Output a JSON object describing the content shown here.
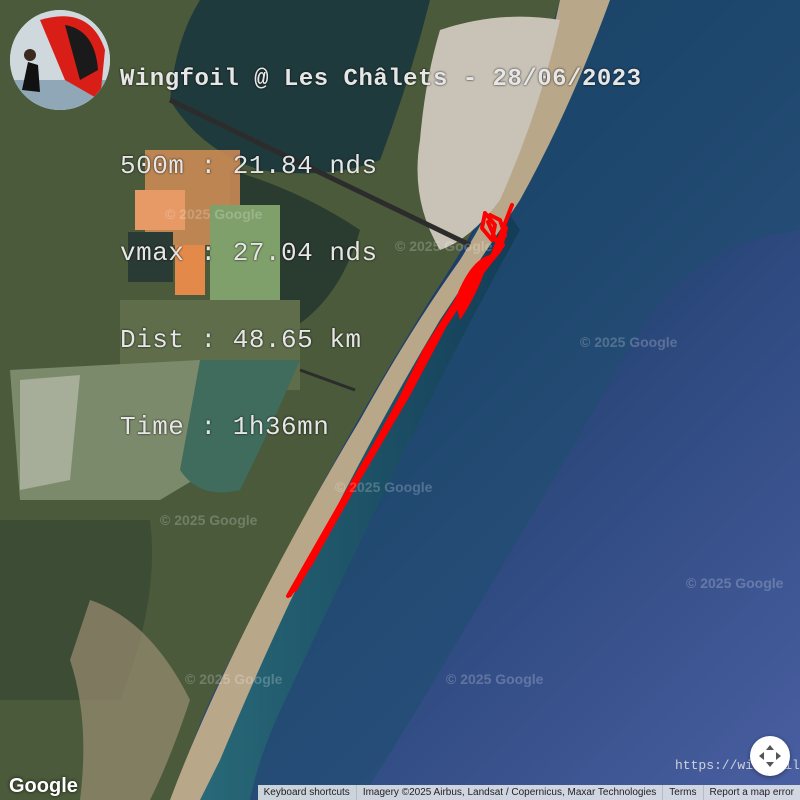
{
  "overlay": {
    "title": "Wingfoil @ Les Châlets - 28/06/2023",
    "stat_500m": "500m : 21.84 nds",
    "stat_vmax": "vmax : 27.04 nds",
    "stat_dist": "Dist : 48.65 km",
    "stat_time": "Time : 1h36mn"
  },
  "track": {
    "color": "#ff0000"
  },
  "watermarks": [
    "© 2025 Google",
    "© 2025 Google",
    "© 2025 Google",
    "© 2025 Google",
    "© 2025 Google",
    "© 2025 Google",
    "© 2025 Google",
    "© 2025 Google"
  ],
  "site_url": "https://windfoil.org",
  "google_logo": "Google",
  "attribution": {
    "shortcuts": "Keyboard shortcuts",
    "imagery": "Imagery ©2025 Airbus, Landsat / Copernicus, Maxar Technologies",
    "terms": "Terms",
    "report": "Report a map error"
  },
  "controls": {
    "camera_icon": "move-arrows-icon"
  }
}
